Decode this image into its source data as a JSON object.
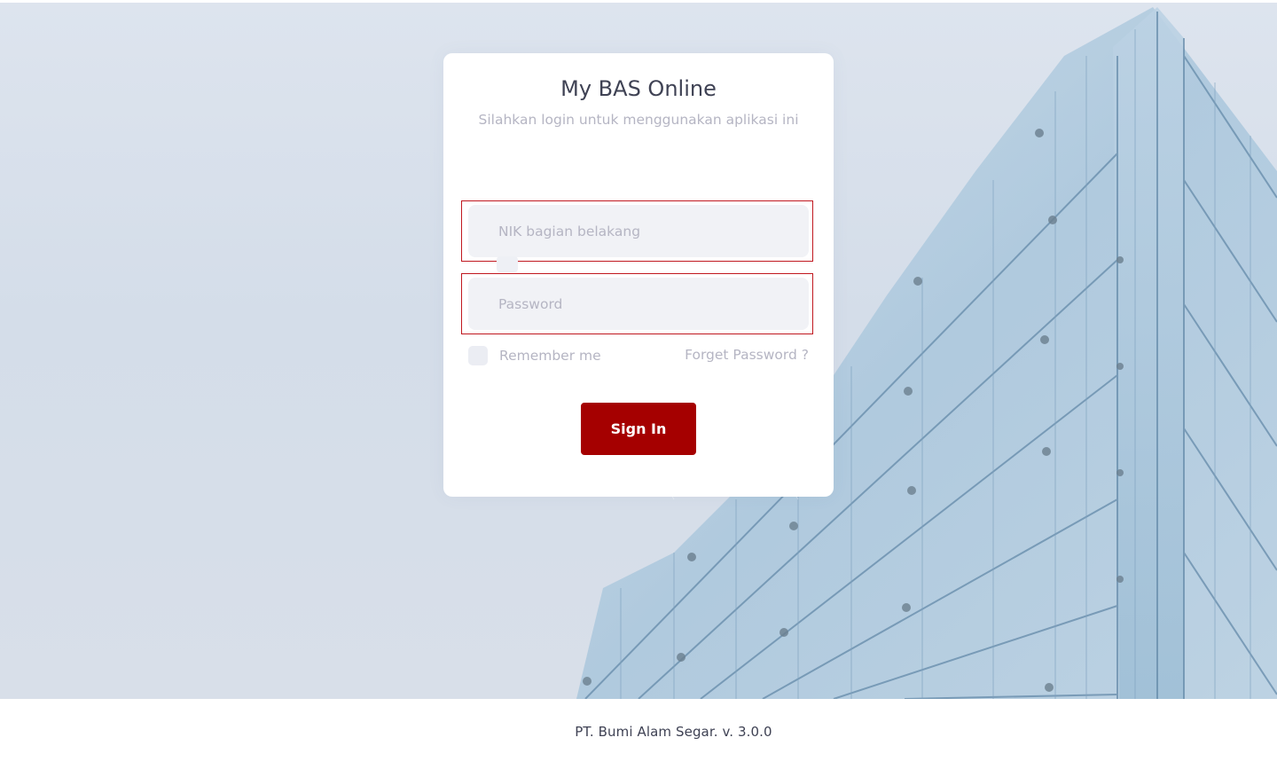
{
  "login": {
    "title": "My BAS Online",
    "subtitle": "Silahkan login untuk menggunakan aplikasi ini",
    "nik_placeholder": "NIK bagian belakang",
    "password_placeholder": "Password",
    "remember_label": "Remember me",
    "forget_label": "Forget Password ?",
    "signin_label": "Sign In"
  },
  "footer": {
    "text": "PT. Bumi Alam Segar. v. 3.0.0"
  },
  "colors": {
    "accent": "#a50000",
    "error_border": "#c0181f",
    "input_bg": "#f1f2f6",
    "muted_text": "#b5b5c3",
    "title_text": "#3f4254"
  }
}
